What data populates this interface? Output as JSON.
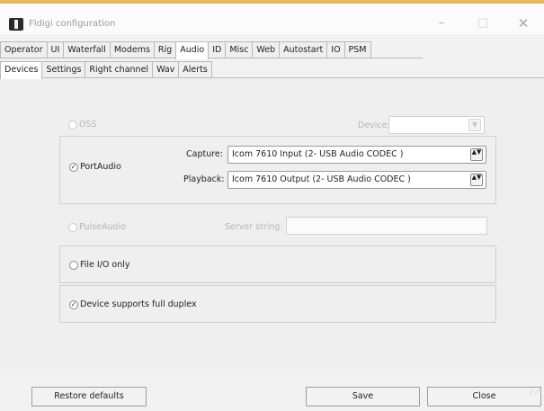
{
  "window": {
    "title": "Fldigi configuration",
    "minimize_glyph": "–",
    "maximize_glyph": "□",
    "close_glyph": "✕"
  },
  "main_tabs": [
    {
      "label": "Operator"
    },
    {
      "label": "UI"
    },
    {
      "label": "Waterfall"
    },
    {
      "label": "Modems"
    },
    {
      "label": "Rig"
    },
    {
      "label": "Audio",
      "active": true
    },
    {
      "label": "ID"
    },
    {
      "label": "Misc"
    },
    {
      "label": "Web"
    },
    {
      "label": "Autostart"
    },
    {
      "label": "IO"
    },
    {
      "label": "PSM"
    }
  ],
  "sub_tabs": [
    {
      "label": "Devices",
      "active": true
    },
    {
      "label": "Settings"
    },
    {
      "label": "Right channel"
    },
    {
      "label": "Wav"
    },
    {
      "label": "Alerts"
    }
  ],
  "devices": {
    "oss": {
      "label": "OSS",
      "checked": false,
      "enabled": false,
      "device_label": "Device:",
      "device_value": ""
    },
    "portaudio": {
      "label": "PortAudio",
      "checked": true,
      "enabled": true,
      "capture_label": "Capture:",
      "capture_value": "Icom 7610 Input (2- USB Audio CODEC )",
      "playback_label": "Playback:",
      "playback_value": "Icom 7610 Output (2- USB Audio CODEC )"
    },
    "pulseaudio": {
      "label": "PulseAudio",
      "checked": false,
      "enabled": false,
      "server_label": "Server string:",
      "server_value": ""
    },
    "file_io": {
      "label": "File I/O only",
      "checked": false
    },
    "full_duplex": {
      "label": "Device supports full duplex",
      "checked": true
    }
  },
  "footer": {
    "restore_label": "Restore defaults",
    "save_label": "Save",
    "close_label": "Close"
  },
  "icons": {
    "checked_glyph": "✓",
    "dropdown_glyph": "▼",
    "spinner_glyph": "▲▼",
    "grip_glyph": "⟋⟋"
  }
}
